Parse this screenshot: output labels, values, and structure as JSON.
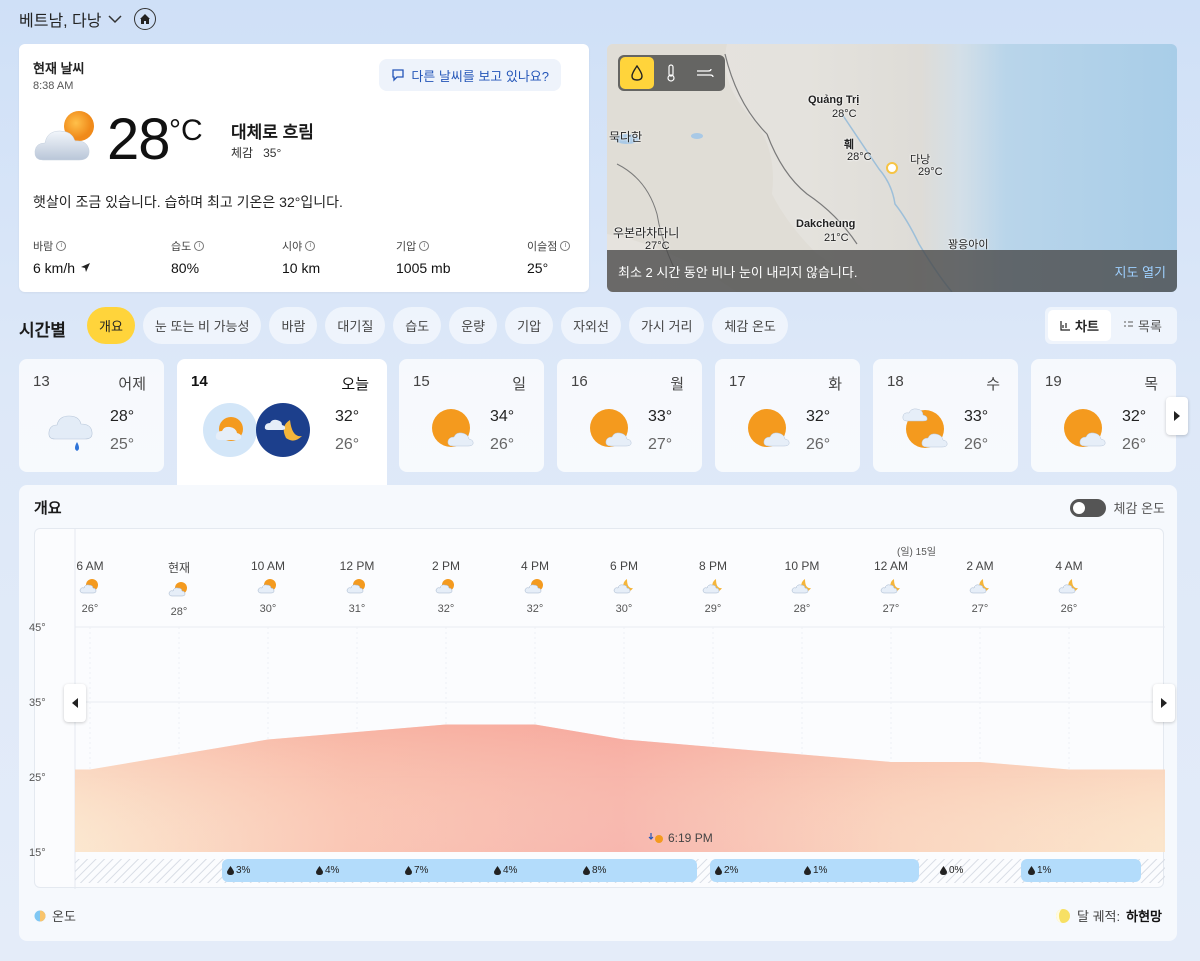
{
  "location": {
    "name": "베트남, 다낭"
  },
  "current": {
    "title": "현재 날씨",
    "time": "8:38 AM",
    "ask_label": "다른 날씨를 보고 있나요?",
    "temp": "28",
    "unit": "°C",
    "condition": "대체로 흐림",
    "feels_label": "체감",
    "feels_value": "35°",
    "description": "햇살이 조금 있습니다. 습하며 최고 기온은 32°입니다.",
    "stats": [
      {
        "label": "바람",
        "value": "6 km/h"
      },
      {
        "label": "습도",
        "value": "80%"
      },
      {
        "label": "시야",
        "value": "10 km"
      },
      {
        "label": "기압",
        "value": "1005 mb"
      },
      {
        "label": "이슬점",
        "value": "25°"
      }
    ]
  },
  "map": {
    "cities": [
      {
        "name": "Quảng Trị",
        "temp": "28°C"
      },
      {
        "name": "훼",
        "temp": "28°C"
      },
      {
        "name": "다낭",
        "temp": "29°C"
      },
      {
        "name": "묵다한",
        "temp": ""
      },
      {
        "name": "우본라차다니",
        "temp": "27°C"
      },
      {
        "name": "Dakcheung",
        "temp": "21°C"
      },
      {
        "name": "꽝응아이",
        "temp": ""
      }
    ],
    "notice": "최소 2 시간 동안 비나 눈이 내리지 않습니다.",
    "open_label": "지도 열기"
  },
  "hourly": {
    "title": "시간별",
    "chips": [
      "개요",
      "눈 또는 비 가능성",
      "바람",
      "대기질",
      "습도",
      "운량",
      "기압",
      "자외선",
      "가시 거리",
      "체감 온도"
    ],
    "view_chart": "차트",
    "view_list": "목록"
  },
  "days": [
    {
      "date": "13",
      "weekday": "어제",
      "hi": "28°",
      "lo": "25°"
    },
    {
      "date": "14",
      "weekday": "오늘",
      "hi": "32°",
      "lo": "26°"
    },
    {
      "date": "15",
      "weekday": "일",
      "hi": "34°",
      "lo": "26°"
    },
    {
      "date": "16",
      "weekday": "월",
      "hi": "33°",
      "lo": "27°"
    },
    {
      "date": "17",
      "weekday": "화",
      "hi": "32°",
      "lo": "26°"
    },
    {
      "date": "18",
      "weekday": "수",
      "hi": "33°",
      "lo": "26°"
    },
    {
      "date": "19",
      "weekday": "목",
      "hi": "32°",
      "lo": "26°"
    }
  ],
  "overview": {
    "title": "개요",
    "feels_toggle": "체감 온도",
    "next_day_label": "(일) 15일",
    "sunset": "6:19 PM",
    "legend_temp": "온도",
    "moon_label": "달 궤적:",
    "moon_phase": "하현망"
  },
  "chart_data": {
    "type": "area",
    "title": "개요",
    "x": [
      "6 AM",
      "현재",
      "10 AM",
      "12 PM",
      "2 PM",
      "4 PM",
      "6 PM",
      "8 PM",
      "10 PM",
      "12 AM",
      "2 AM",
      "4 AM"
    ],
    "temps_label": [
      "26°",
      "28°",
      "30°",
      "31°",
      "32°",
      "32°",
      "30°",
      "29°",
      "28°",
      "27°",
      "27°",
      "26°"
    ],
    "series": [
      {
        "name": "온도",
        "values": [
          26,
          28,
          30,
          31,
          32,
          32,
          30,
          29,
          28,
          27,
          27,
          26
        ]
      }
    ],
    "yticks": [
      "45°",
      "35°",
      "25°",
      "15°"
    ],
    "ylim": [
      15,
      45
    ],
    "precip": [
      "3%",
      "4%",
      "7%",
      "4%",
      "8%",
      "2%",
      "1%",
      "0%",
      "1%"
    ],
    "colors": {
      "warm": "#f7a89a",
      "mild": "#f9d9a8",
      "rain": "#b3dcfb"
    }
  }
}
